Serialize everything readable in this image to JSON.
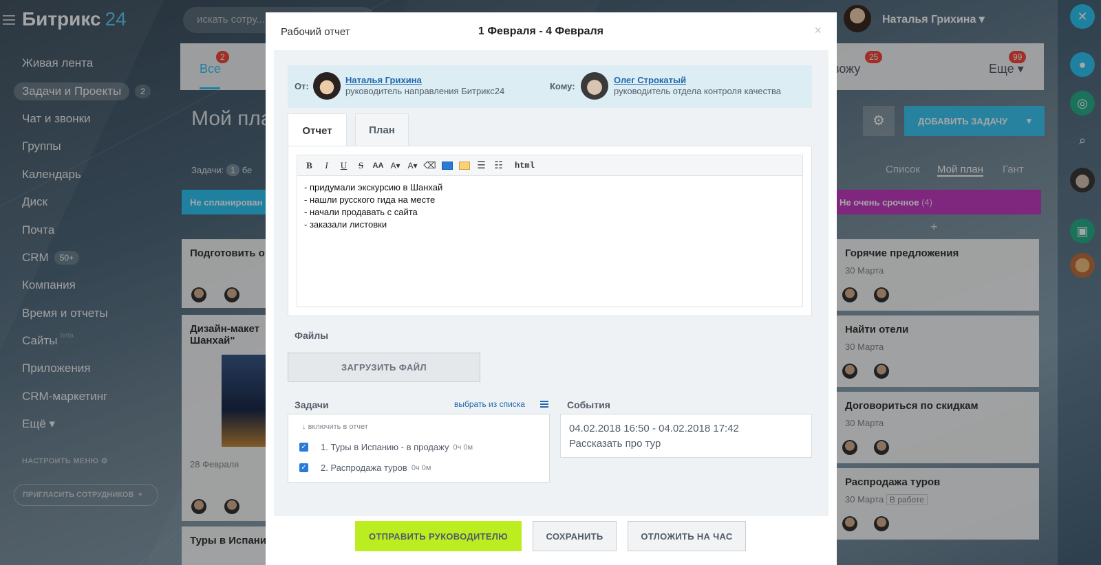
{
  "app": {
    "logo_name": "Битрикс",
    "logo_num": "24",
    "search_placeholder": "искать сотру...",
    "user_name": "Наталья Грихина"
  },
  "sidebar": {
    "items": [
      {
        "label": "Живая лента"
      },
      {
        "label": "Задачи и Проекты",
        "badge": "2",
        "active": true
      },
      {
        "label": "Чат и звонки"
      },
      {
        "label": "Группы"
      },
      {
        "label": "Календарь"
      },
      {
        "label": "Диск"
      },
      {
        "label": "Почта"
      },
      {
        "label": "CRM",
        "badge": "50+"
      },
      {
        "label": "Компания"
      },
      {
        "label": "Время и отчеты"
      },
      {
        "label": "Сайты",
        "beta": "beta"
      },
      {
        "label": "Приложения"
      },
      {
        "label": "CRM-маркетинг"
      },
      {
        "label": "Ещё ▾"
      }
    ],
    "settings_label": "НАСТРОИТЬ МЕНЮ",
    "invite_label": "ПРИГЛАСИТЬ СОТРУДНИКОВ"
  },
  "main": {
    "tab_all": "Все",
    "tab_all_badge": "2",
    "tab_watch": "овожу",
    "tab_watch_badge": "25",
    "tab_more": "Еще ▾",
    "tab_more_badge": "99",
    "page_title": "Мой пла",
    "add_task": "ДОБАВИТЬ ЗАДАЧУ",
    "tasks_label": "Задачи:",
    "tasks_count": "1",
    "tasks_after": "бе",
    "views": [
      "Список",
      "Мой план",
      "Гант"
    ],
    "col_left": "Не спланирован",
    "col_right": "Не очень срочное",
    "col_right_count": "(4)",
    "left_cards": [
      {
        "title": "Подготовить о"
      },
      {
        "title": "Дизайн-макет Шанхай\"",
        "date": "28 Февраля"
      },
      {
        "title": "Туры в Испани"
      }
    ],
    "right_cards": [
      {
        "title": "Горячие предложения",
        "date": "30 Марта"
      },
      {
        "title": "Найти отели",
        "date": "30 Марта"
      },
      {
        "title": "Договориться по скидкам",
        "date": "30 Марта"
      },
      {
        "title": "Распродажа туров",
        "date": "30 Марта",
        "status": "В работе"
      }
    ]
  },
  "modal": {
    "title": "Рабочий отчет",
    "date_range": "1 Февраля - 4 Февраля",
    "close": "×",
    "from_label": "От:",
    "from_name": "Наталья Грихина",
    "from_role": "руководитель направления Битрикс24",
    "to_label": "Кому:",
    "to_name": "Олег Строкатый",
    "to_role": "руководитель отдела контроля качества",
    "tab_report": "Отчет",
    "tab_plan": "План",
    "toolbar_html": "html",
    "report_lines": [
      "- придумали экскурсию в Шанхай",
      "- нашли русского гида на месте",
      "- начали продавать с сайта",
      "- заказали листовки"
    ],
    "files_label": "Файлы",
    "upload_label": "ЗАГРУЗИТЬ ФАЙЛ",
    "tasks_label": "Задачи",
    "pick_link": "выбрать из списка",
    "include_label": "включить в отчет",
    "tasks": [
      {
        "text": "1. Туры в Испанию - в продажу",
        "time": "0ч 0м",
        "checked": true
      },
      {
        "text": "2. Распродажа туров",
        "time": "0ч 0м",
        "checked": true
      }
    ],
    "events_label": "События",
    "event_time": "04.02.2018 16:50 - 04.02.2018 17:42",
    "event_text": "Рассказать про тур",
    "btn_send": "ОТПРАВИТЬ РУКОВОДИТЕЛЮ",
    "btn_save": "СОХРАНИТЬ",
    "btn_defer": "ОТЛОЖИТЬ НА ЧАС"
  },
  "colors": {
    "accent": "#2fc6f6",
    "send_button": "#bbed21",
    "link": "#2067b0",
    "badge": "#f5493c"
  }
}
